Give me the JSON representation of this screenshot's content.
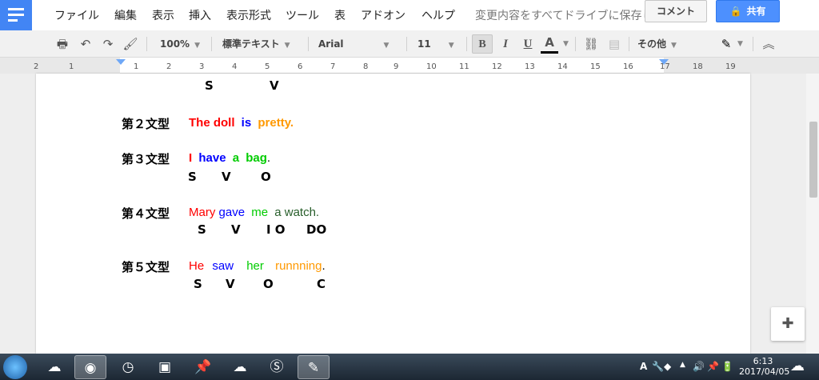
{
  "menubar": {
    "items": [
      "ファイル",
      "編集",
      "表示",
      "挿入",
      "表示形式",
      "ツール",
      "表",
      "アドオン",
      "ヘルプ"
    ],
    "status": "変更内容をすべてドライブに保存しました",
    "comment_label": "コメント",
    "share_label": "共有"
  },
  "toolbar": {
    "zoom": "100%",
    "style": "標準テキスト",
    "font": "Arial",
    "size": "11",
    "bold": "B",
    "italic": "I",
    "underline": "U",
    "text_color": "A",
    "more": "その他"
  },
  "ruler": {
    "numbers": [
      "2",
      "1",
      "1",
      "2",
      "3",
      "4",
      "5",
      "6",
      "7",
      "8",
      "9",
      "10",
      "11",
      "12",
      "13",
      "14",
      "15",
      "16",
      "17",
      "18",
      "19"
    ]
  },
  "document": {
    "prev_sv": {
      "s": "S",
      "v": "V"
    },
    "type2": {
      "label": "第２文型",
      "w1": "The doll",
      "w2": "is",
      "w3": "pretty."
    },
    "type3": {
      "label": "第３文型",
      "w1": "I",
      "w2": "have",
      "w3": "a",
      "w4": "bag",
      "w5": ".",
      "r1": "S",
      "r2": "V",
      "r3": "O"
    },
    "type4": {
      "label": "第４文型",
      "w1": "Mary",
      "w2": "gave",
      "w3": "me",
      "w4": "a watch.",
      "r1": "S",
      "r2": "V",
      "r3": "I O",
      "r4": "DO"
    },
    "type5": {
      "label": "第５文型",
      "w1": "He",
      "w2": "saw",
      "w3": "her",
      "w4": "runnning",
      "w5": ".",
      "r1": "S",
      "r2": "V",
      "r3": "O",
      "r4": "C"
    }
  },
  "taskbar": {
    "time": "6:13",
    "date": "2017/04/05",
    "ime": "A"
  },
  "colors": {
    "red": "#ff0000",
    "blue": "#0000ff",
    "green": "#00cc00",
    "orange": "#ff9900",
    "dark_green": "#275e2a",
    "accent": "#4285f4"
  }
}
